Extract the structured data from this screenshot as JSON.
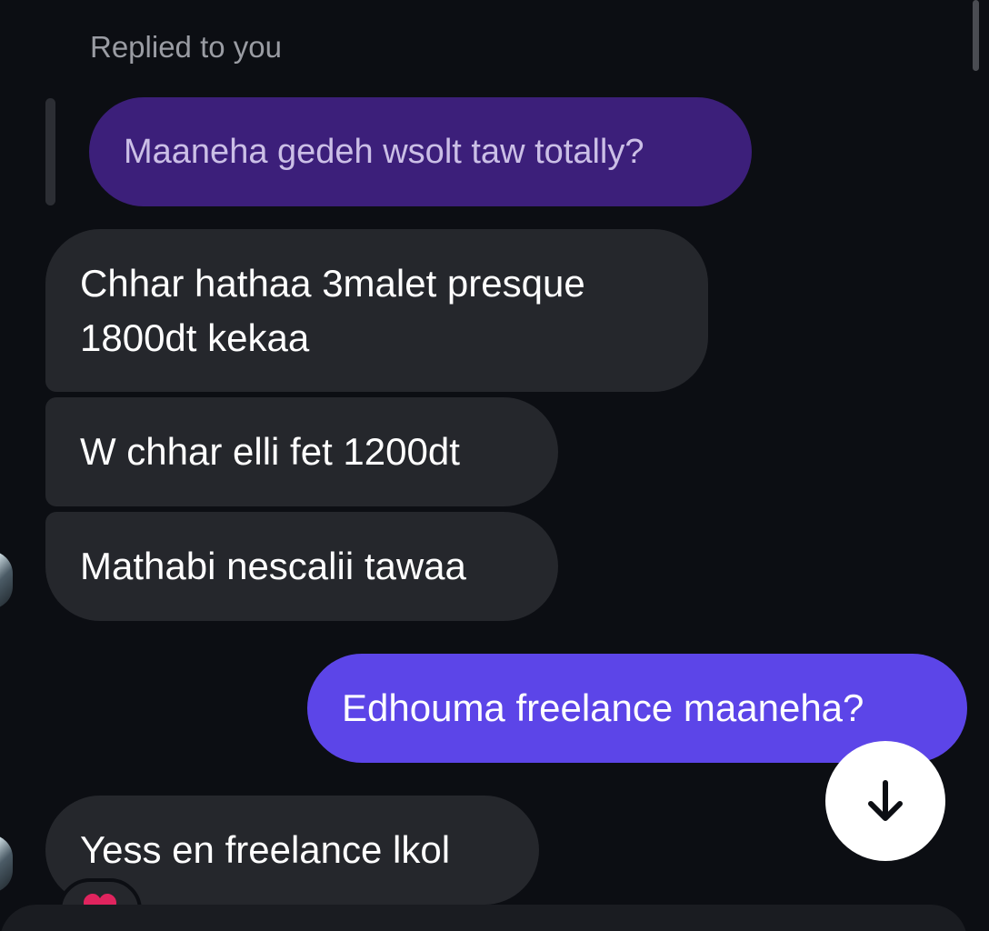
{
  "thread": {
    "reply_context": {
      "label": "Replied to you",
      "quoted_message": "Maaneha gedeh wsolt taw totally?"
    },
    "messages": [
      {
        "direction": "incoming",
        "text": "Chhar hathaa 3malet presque 1800dt kekaa"
      },
      {
        "direction": "incoming",
        "text": "W chhar elli fet 1200dt"
      },
      {
        "direction": "incoming",
        "text": "Mathabi nescalii tawaa"
      },
      {
        "direction": "outgoing",
        "text": "Edhouma freelance maaneha?"
      },
      {
        "direction": "incoming",
        "text": "Yess en freelance lkol",
        "reaction": "heart"
      }
    ]
  },
  "controls": {
    "scroll_to_bottom_icon": "arrow-down-icon"
  },
  "colors": {
    "background": "#0c0e13",
    "incoming_bubble": "#25272c",
    "outgoing_bubble": "#5c45e8",
    "replied_bubble": "#3c1f7a",
    "reaction_heart": "#e0245e"
  }
}
